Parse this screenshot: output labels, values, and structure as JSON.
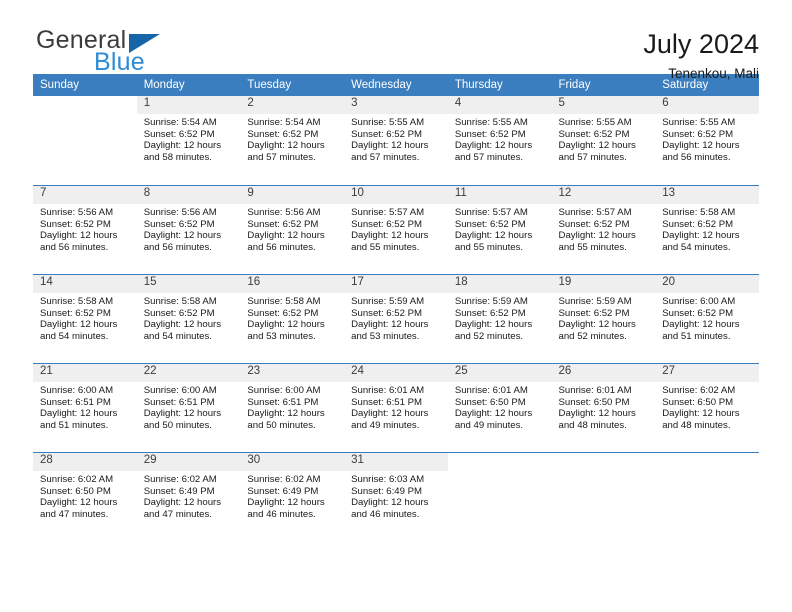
{
  "brand": {
    "name_part1": "General",
    "name_part2": "Blue",
    "accent_color": "#2e8bd4",
    "triangle_color": "#1565a8",
    "triangle_icon": "triangle-icon"
  },
  "header": {
    "title": "July 2024",
    "subtitle": "Tenenkou, Mali"
  },
  "calendar": {
    "header_bg": "#3a7ebf",
    "daynum_bg": "#efefef",
    "weekdays": [
      "Sunday",
      "Monday",
      "Tuesday",
      "Wednesday",
      "Thursday",
      "Friday",
      "Saturday"
    ],
    "weeks": [
      [
        {
          "day": "",
          "sunrise": "",
          "sunset": "",
          "daylight_line1": "",
          "daylight_line2": ""
        },
        {
          "day": "1",
          "sunrise": "Sunrise: 5:54 AM",
          "sunset": "Sunset: 6:52 PM",
          "daylight_line1": "Daylight: 12 hours",
          "daylight_line2": "and 58 minutes."
        },
        {
          "day": "2",
          "sunrise": "Sunrise: 5:54 AM",
          "sunset": "Sunset: 6:52 PM",
          "daylight_line1": "Daylight: 12 hours",
          "daylight_line2": "and 57 minutes."
        },
        {
          "day": "3",
          "sunrise": "Sunrise: 5:55 AM",
          "sunset": "Sunset: 6:52 PM",
          "daylight_line1": "Daylight: 12 hours",
          "daylight_line2": "and 57 minutes."
        },
        {
          "day": "4",
          "sunrise": "Sunrise: 5:55 AM",
          "sunset": "Sunset: 6:52 PM",
          "daylight_line1": "Daylight: 12 hours",
          "daylight_line2": "and 57 minutes."
        },
        {
          "day": "5",
          "sunrise": "Sunrise: 5:55 AM",
          "sunset": "Sunset: 6:52 PM",
          "daylight_line1": "Daylight: 12 hours",
          "daylight_line2": "and 57 minutes."
        },
        {
          "day": "6",
          "sunrise": "Sunrise: 5:55 AM",
          "sunset": "Sunset: 6:52 PM",
          "daylight_line1": "Daylight: 12 hours",
          "daylight_line2": "and 56 minutes."
        }
      ],
      [
        {
          "day": "7",
          "sunrise": "Sunrise: 5:56 AM",
          "sunset": "Sunset: 6:52 PM",
          "daylight_line1": "Daylight: 12 hours",
          "daylight_line2": "and 56 minutes."
        },
        {
          "day": "8",
          "sunrise": "Sunrise: 5:56 AM",
          "sunset": "Sunset: 6:52 PM",
          "daylight_line1": "Daylight: 12 hours",
          "daylight_line2": "and 56 minutes."
        },
        {
          "day": "9",
          "sunrise": "Sunrise: 5:56 AM",
          "sunset": "Sunset: 6:52 PM",
          "daylight_line1": "Daylight: 12 hours",
          "daylight_line2": "and 56 minutes."
        },
        {
          "day": "10",
          "sunrise": "Sunrise: 5:57 AM",
          "sunset": "Sunset: 6:52 PM",
          "daylight_line1": "Daylight: 12 hours",
          "daylight_line2": "and 55 minutes."
        },
        {
          "day": "11",
          "sunrise": "Sunrise: 5:57 AM",
          "sunset": "Sunset: 6:52 PM",
          "daylight_line1": "Daylight: 12 hours",
          "daylight_line2": "and 55 minutes."
        },
        {
          "day": "12",
          "sunrise": "Sunrise: 5:57 AM",
          "sunset": "Sunset: 6:52 PM",
          "daylight_line1": "Daylight: 12 hours",
          "daylight_line2": "and 55 minutes."
        },
        {
          "day": "13",
          "sunrise": "Sunrise: 5:58 AM",
          "sunset": "Sunset: 6:52 PM",
          "daylight_line1": "Daylight: 12 hours",
          "daylight_line2": "and 54 minutes."
        }
      ],
      [
        {
          "day": "14",
          "sunrise": "Sunrise: 5:58 AM",
          "sunset": "Sunset: 6:52 PM",
          "daylight_line1": "Daylight: 12 hours",
          "daylight_line2": "and 54 minutes."
        },
        {
          "day": "15",
          "sunrise": "Sunrise: 5:58 AM",
          "sunset": "Sunset: 6:52 PM",
          "daylight_line1": "Daylight: 12 hours",
          "daylight_line2": "and 54 minutes."
        },
        {
          "day": "16",
          "sunrise": "Sunrise: 5:58 AM",
          "sunset": "Sunset: 6:52 PM",
          "daylight_line1": "Daylight: 12 hours",
          "daylight_line2": "and 53 minutes."
        },
        {
          "day": "17",
          "sunrise": "Sunrise: 5:59 AM",
          "sunset": "Sunset: 6:52 PM",
          "daylight_line1": "Daylight: 12 hours",
          "daylight_line2": "and 53 minutes."
        },
        {
          "day": "18",
          "sunrise": "Sunrise: 5:59 AM",
          "sunset": "Sunset: 6:52 PM",
          "daylight_line1": "Daylight: 12 hours",
          "daylight_line2": "and 52 minutes."
        },
        {
          "day": "19",
          "sunrise": "Sunrise: 5:59 AM",
          "sunset": "Sunset: 6:52 PM",
          "daylight_line1": "Daylight: 12 hours",
          "daylight_line2": "and 52 minutes."
        },
        {
          "day": "20",
          "sunrise": "Sunrise: 6:00 AM",
          "sunset": "Sunset: 6:52 PM",
          "daylight_line1": "Daylight: 12 hours",
          "daylight_line2": "and 51 minutes."
        }
      ],
      [
        {
          "day": "21",
          "sunrise": "Sunrise: 6:00 AM",
          "sunset": "Sunset: 6:51 PM",
          "daylight_line1": "Daylight: 12 hours",
          "daylight_line2": "and 51 minutes."
        },
        {
          "day": "22",
          "sunrise": "Sunrise: 6:00 AM",
          "sunset": "Sunset: 6:51 PM",
          "daylight_line1": "Daylight: 12 hours",
          "daylight_line2": "and 50 minutes."
        },
        {
          "day": "23",
          "sunrise": "Sunrise: 6:00 AM",
          "sunset": "Sunset: 6:51 PM",
          "daylight_line1": "Daylight: 12 hours",
          "daylight_line2": "and 50 minutes."
        },
        {
          "day": "24",
          "sunrise": "Sunrise: 6:01 AM",
          "sunset": "Sunset: 6:51 PM",
          "daylight_line1": "Daylight: 12 hours",
          "daylight_line2": "and 49 minutes."
        },
        {
          "day": "25",
          "sunrise": "Sunrise: 6:01 AM",
          "sunset": "Sunset: 6:50 PM",
          "daylight_line1": "Daylight: 12 hours",
          "daylight_line2": "and 49 minutes."
        },
        {
          "day": "26",
          "sunrise": "Sunrise: 6:01 AM",
          "sunset": "Sunset: 6:50 PM",
          "daylight_line1": "Daylight: 12 hours",
          "daylight_line2": "and 48 minutes."
        },
        {
          "day": "27",
          "sunrise": "Sunrise: 6:02 AM",
          "sunset": "Sunset: 6:50 PM",
          "daylight_line1": "Daylight: 12 hours",
          "daylight_line2": "and 48 minutes."
        }
      ],
      [
        {
          "day": "28",
          "sunrise": "Sunrise: 6:02 AM",
          "sunset": "Sunset: 6:50 PM",
          "daylight_line1": "Daylight: 12 hours",
          "daylight_line2": "and 47 minutes."
        },
        {
          "day": "29",
          "sunrise": "Sunrise: 6:02 AM",
          "sunset": "Sunset: 6:49 PM",
          "daylight_line1": "Daylight: 12 hours",
          "daylight_line2": "and 47 minutes."
        },
        {
          "day": "30",
          "sunrise": "Sunrise: 6:02 AM",
          "sunset": "Sunset: 6:49 PM",
          "daylight_line1": "Daylight: 12 hours",
          "daylight_line2": "and 46 minutes."
        },
        {
          "day": "31",
          "sunrise": "Sunrise: 6:03 AM",
          "sunset": "Sunset: 6:49 PM",
          "daylight_line1": "Daylight: 12 hours",
          "daylight_line2": "and 46 minutes."
        },
        {
          "day": "",
          "sunrise": "",
          "sunset": "",
          "daylight_line1": "",
          "daylight_line2": ""
        },
        {
          "day": "",
          "sunrise": "",
          "sunset": "",
          "daylight_line1": "",
          "daylight_line2": ""
        },
        {
          "day": "",
          "sunrise": "",
          "sunset": "",
          "daylight_line1": "",
          "daylight_line2": ""
        }
      ]
    ]
  }
}
